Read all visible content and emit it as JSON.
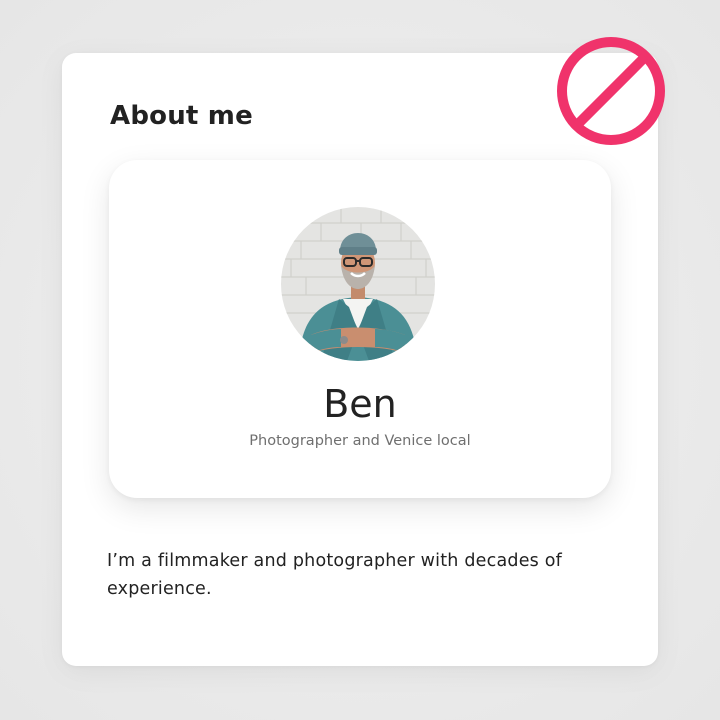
{
  "section": {
    "title": "About me"
  },
  "profile": {
    "name": "Ben",
    "subtitle": "Photographer and Venice local",
    "avatar_icon": "host-photo"
  },
  "bio": {
    "text": "I’m a filmmaker and photographer with decades of experience."
  },
  "overlay": {
    "icon": "prohibited-icon",
    "color": "#f0336b"
  },
  "colors": {
    "background": "#ebebeb",
    "card": "#ffffff",
    "text_primary": "#222222",
    "text_secondary": "#6f6f6f"
  }
}
